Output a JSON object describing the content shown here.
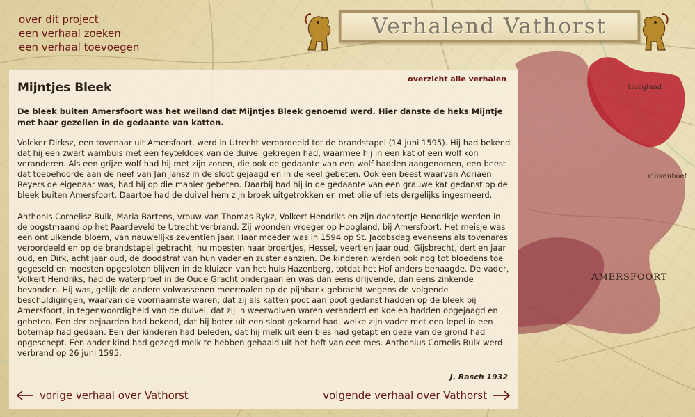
{
  "nav": {
    "about": "over dit project",
    "search": "een verhaal zoeken",
    "add": "een verhaal toevoegen"
  },
  "banner": {
    "title": "Verhalend Vathorst"
  },
  "map": {
    "labels": [
      "Hoogland",
      "Vinkenhoef",
      "AMERSFOORT"
    ],
    "highlight_color": "#b81e2e",
    "region_color": "#9a3a4a"
  },
  "story": {
    "overview_link": "overzicht alle verhalen",
    "title": "Mijntjes Bleek",
    "lead": "De bleek buiten Amersfoort was het weiland dat Mijntjes Bleek genoemd werd. Hier danste de heks Mijntje met haar gezellen in de gedaante van katten.",
    "paragraph1": "Volcker Dirksz, een tovenaar uit Amersfoort, werd in Utrecht veroordeeld tot de brandstapel (14 juni 1595). Hij had bekend dat hij een zwart wambuis met een feyteldoek van de duivel gekregen had, waarmee hij in een kat of een wolf kon veranderen. Als een grijze wolf had hij met zijn zonen, die ook de gedaante van een wolf hadden aangenomen, een beest dat toebehoorde aan de neef van Jan Jansz in de sloot gejaagd en in de keel gebeten. Ook een beest waarvan Adriaen Reyers de eigenaar was, had hij op die manier gebeten. Daarbij had hij in de gedaante van een grauwe kat gedanst op de bleek buiten Amersfoort. Daartoe had de duivel hem zijn broek uitgetrokken en met olie of iets dergelijks ingesmeerd.",
    "paragraph2": "Anthonis Cornelisz Bulk, Maria Bartens, vrouw van Thomas Rykz, Volkert Hendriks en zijn dochtertje Hendrikje werden in de oogstmaand op het Paardeveld te Utrecht verbrand. Zij woonden vroeger op Hoogland, bij Amersfoort. Het meisje was een ontluikende bloem, van nauwelijks zeventien jaar. Haar moeder was in 1594 op St. Jacobsdag eveneens als tovenares veroordeeld en op de brandstapel gebracht, nu moesten haar broertjes, Hessel, veertien jaar oud, Gijsbrecht, dertien jaar oud, en Dirk, acht jaar oud, de doodstraf van hun vader en zuster aanzien. De kinderen werden ook nog tot bloedens toe gegeseld en moesten opgesloten blijven in de kluizen van het huis Hazenberg, totdat het Hof anders behaagde. De vader, Volkert Hendriks, had de waterproef in de Oude Gracht ondergaan en was dan eens drijvende, dan eens zinkende bevonden. Hij was, gelijk de andere volwassenen meermalen op de pijnbank gebracht wegens de volgende beschuldigingen, waarvan de voornaamste waren, dat zij als katten poot aan poot gedanst hadden op de bleek bij Amersfoort, in tegenwoordigheid van de duivel, dat zij in weerwolven waren veranderd en koeien hadden opgejaagd en gebeten. Een der bejaarden had bekend, dat hij boter uit een sloot gekarnd had, welke zijn vader met een lepel in een boternap had gedaan. Een der kinderen had beleden, dat hij melk uit een bies had getapt en deze van de grond had opgeschept. Een ander kind had gezegd melk te hebben gehaald uit het heft van een mes. Anthonius Cornelis Bulk werd verbrand op 26 juni 1595.",
    "author": "J. Rasch 1932",
    "prev_link": "vorige verhaal over Vathorst",
    "next_link": "volgende verhaal over Vathorst"
  }
}
